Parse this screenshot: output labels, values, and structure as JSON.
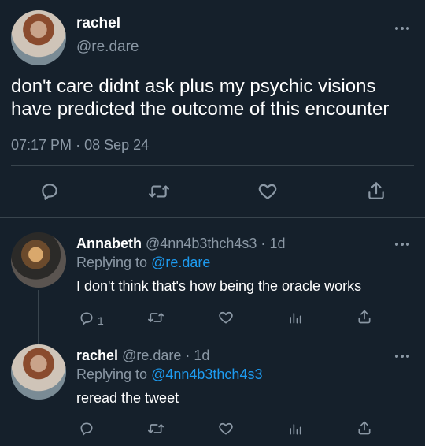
{
  "main_tweet": {
    "display_name": "rachel",
    "handle": "@re.dare",
    "text_line1": "don't care didnt ask plus my psychic visions",
    "text_line2": "have predicted the outcome of this encounter",
    "time": "07:17 PM",
    "dot": "·",
    "date": "08 Sep 24"
  },
  "reply1": {
    "display_name": "Annabeth",
    "handle": "@4nn4b3thch4s3",
    "sep": "·",
    "age": "1d",
    "replying_prefix": "Replying to",
    "replying_to": "@re.dare",
    "text": "I don't think that's how being the oracle works",
    "reply_count": "1"
  },
  "reply2": {
    "display_name": "rachel",
    "handle": "@re.dare",
    "sep": "·",
    "age": "1d",
    "replying_prefix": "Replying to",
    "replying_to": "@4nn4b3thch4s3",
    "text": "reread the tweet"
  },
  "icons": [
    "reply-icon",
    "retweet-icon",
    "like-icon",
    "share-icon",
    "analytics-icon",
    "more-icon"
  ],
  "colors": {
    "background": "#15202b",
    "accent": "#1d9bf0",
    "muted": "#8b98a5",
    "divider": "#38444d"
  }
}
